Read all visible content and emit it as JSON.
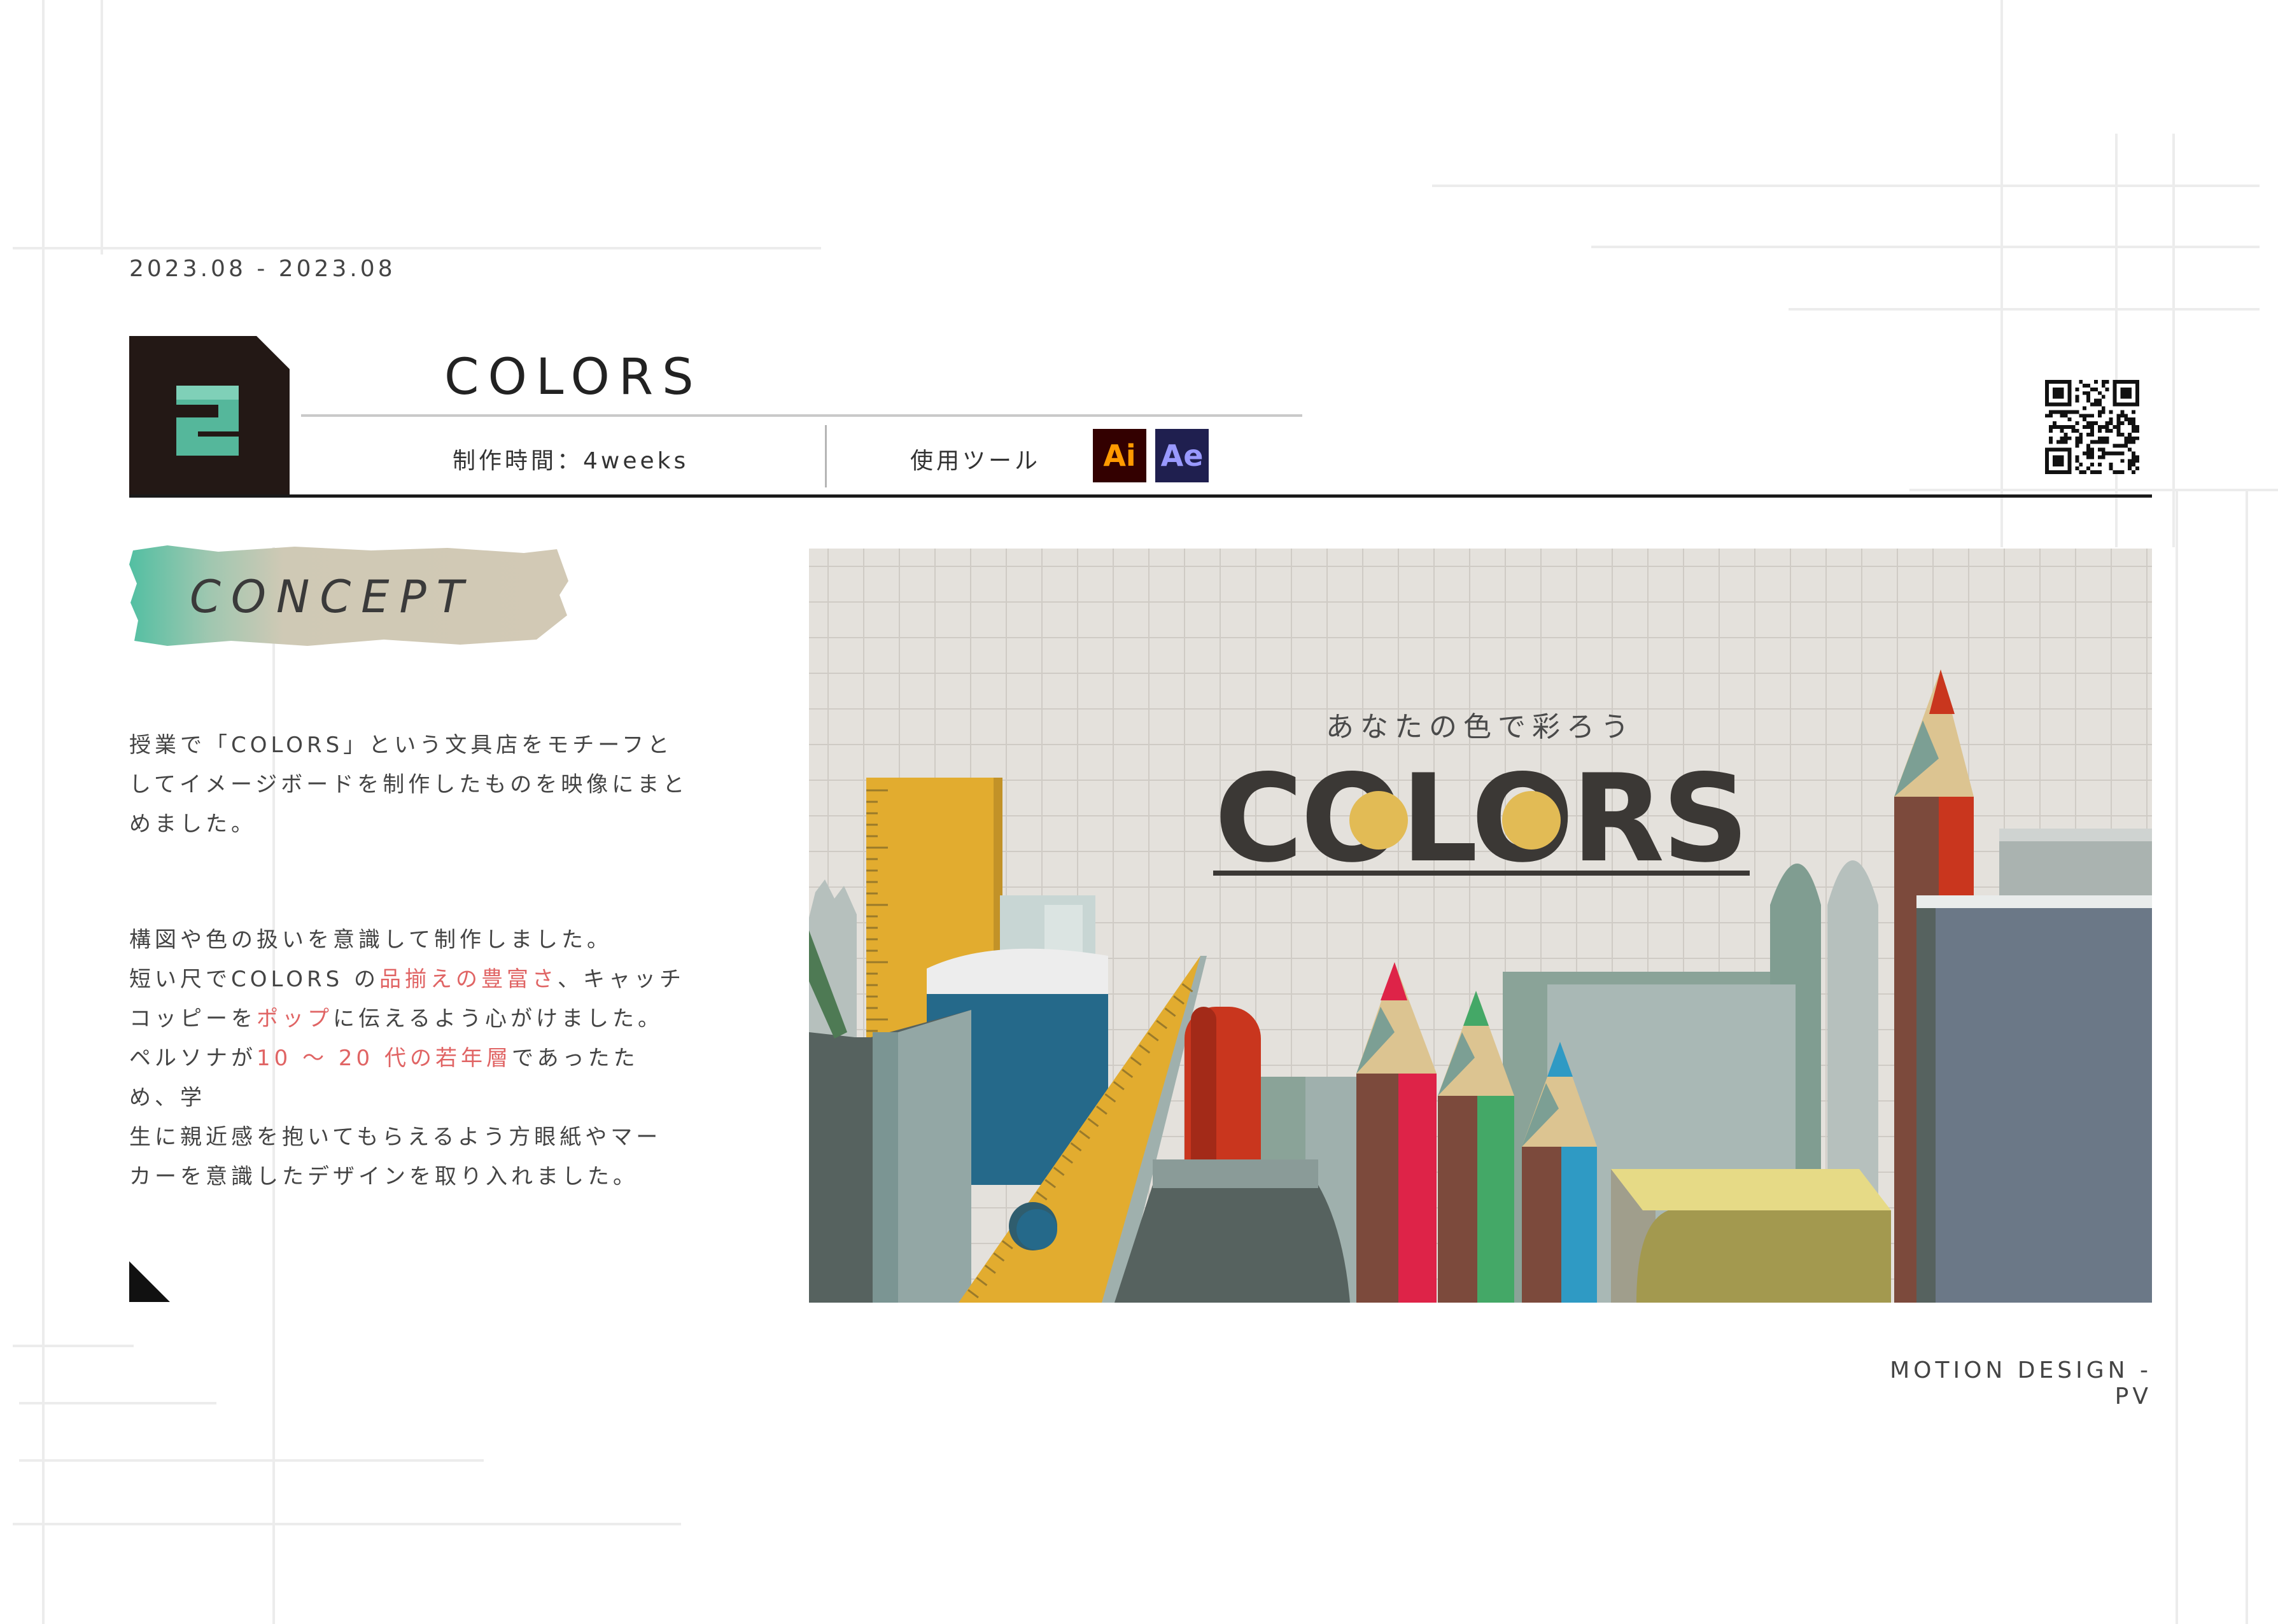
{
  "header": {
    "date_range": "2023.08 - 2023.08",
    "title": "COLORS",
    "production_time": "制作時間：4weeks",
    "tools_label": "使用ツール",
    "tools": [
      {
        "name": "Ai",
        "bg": "#330000",
        "fg": "#ff9a00"
      },
      {
        "name": "Ae",
        "bg": "#1f1f4f",
        "fg": "#9999ff"
      }
    ]
  },
  "concept": {
    "heading": "CONCEPT",
    "paragraph1": "授業で「COLORS」という文具店をモチーフとしてイメージボードを制作したものを映像にまとめました。",
    "p2_line1": "構図や色の扱いを意識して制作しました。",
    "p2_line2_a": "短い尺でCOLORS の",
    "p2_line2_hl": "品揃えの豊富さ",
    "p2_line2_b": "、キャッチ",
    "p2_line3_a": "コッピーを",
    "p2_line3_hl": "ポップ",
    "p2_line3_b": "に伝えるよう心がけました。",
    "p2_line4_a": "ペルソナが",
    "p2_line4_hl": "10 ～ 20 代の若年層",
    "p2_line4_b": "であったため、学",
    "p2_line5": "生に親近感を抱いてもらえるよう方眼紙やマー",
    "p2_line6": "カーを意識したデザインを取り入れました。",
    "highlight_color": "#e06464"
  },
  "hero": {
    "catch_copy": "あなたの色で彩ろう",
    "logo": "COLORS"
  },
  "footer": {
    "category": "MOTION DESIGN - PV"
  }
}
